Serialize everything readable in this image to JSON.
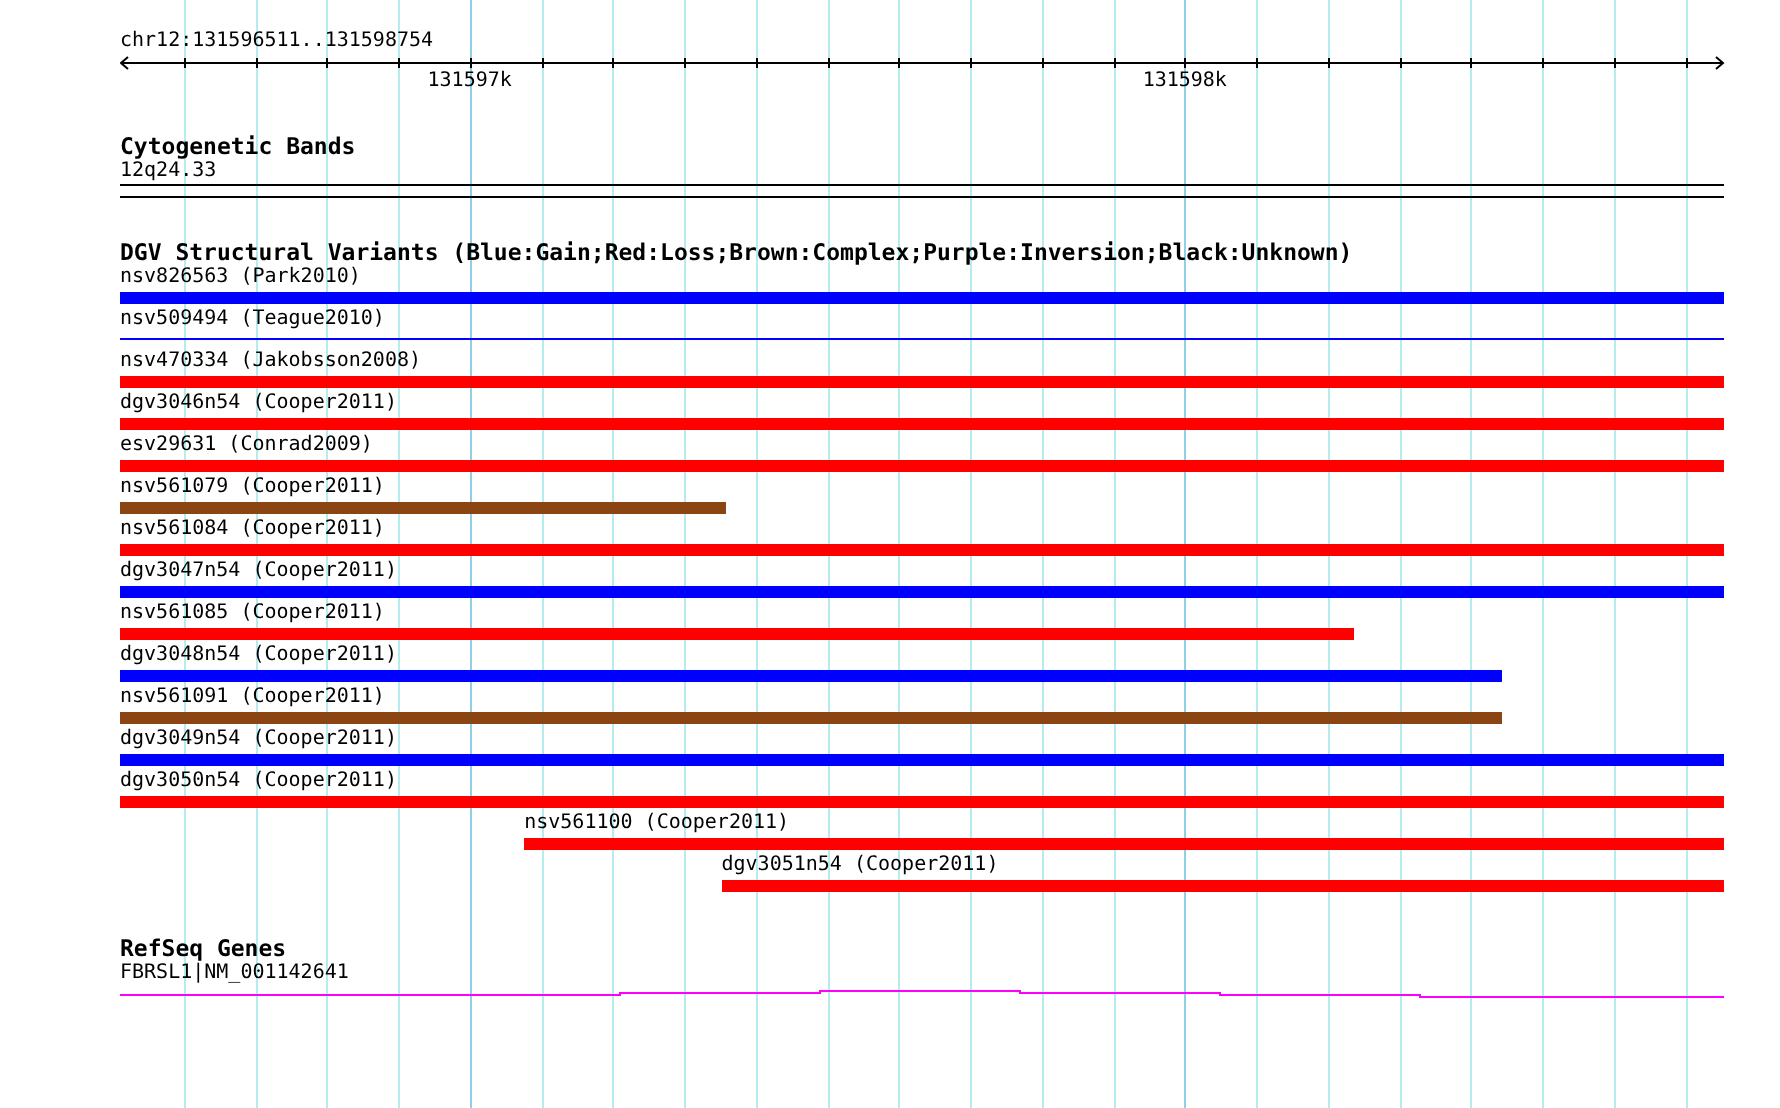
{
  "ruler": {
    "range": "chr12:131596511..131598754",
    "tick_labels": [
      "131597k",
      "131598k"
    ]
  },
  "tracks": [
    {
      "title": "Cytogenetic Bands",
      "kind": "bands",
      "features": [
        {
          "label": "12q24.33"
        }
      ]
    },
    {
      "title": "DGV Structural Variants (Blue:Gain;Red:Loss;Brown:Complex;Purple:Inversion;Black:Unknown)",
      "kind": "variants",
      "features": [
        {
          "label": "nsv826563 (Park2010)",
          "color": "#0000ff",
          "thin": false
        },
        {
          "label": "nsv509494 (Teague2010)",
          "color": "#0000ff",
          "thin": true
        },
        {
          "label": "nsv470334 (Jakobsson2008)",
          "color": "#ff0000",
          "thin": false
        },
        {
          "label": "dgv3046n54 (Cooper2011)",
          "color": "#ff0000",
          "thin": false
        },
        {
          "label": "esv29631 (Conrad2009)",
          "color": "#ff0000",
          "thin": false
        },
        {
          "label": "nsv561079 (Cooper2011)",
          "color": "#8b4513",
          "thin": false
        },
        {
          "label": "nsv561084 (Cooper2011)",
          "color": "#ff0000",
          "thin": false
        },
        {
          "label": "dgv3047n54 (Cooper2011)",
          "color": "#0000ff",
          "thin": false
        },
        {
          "label": "nsv561085 (Cooper2011)",
          "color": "#ff0000",
          "thin": false
        },
        {
          "label": "dgv3048n54 (Cooper2011)",
          "color": "#0000ff",
          "thin": false
        },
        {
          "label": "nsv561091 (Cooper2011)",
          "color": "#8b4513",
          "thin": false
        },
        {
          "label": "dgv3049n54 (Cooper2011)",
          "color": "#0000ff",
          "thin": false
        },
        {
          "label": "dgv3050n54 (Cooper2011)",
          "color": "#ff0000",
          "thin": false
        },
        {
          "label": "nsv561100 (Cooper2011)",
          "color": "#ff0000",
          "thin": false
        },
        {
          "label": "dgv3051n54 (Cooper2011)",
          "color": "#ff0000",
          "thin": false
        }
      ]
    },
    {
      "title": "RefSeq Genes",
      "kind": "genes",
      "features": [
        {
          "label": "FBRSL1|NM_001142641"
        }
      ]
    }
  ]
}
